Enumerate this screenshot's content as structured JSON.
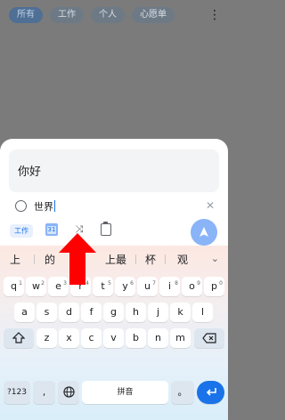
{
  "tabs": [
    {
      "label": "所有",
      "active": true
    },
    {
      "label": "工作",
      "active": false
    },
    {
      "label": "个人",
      "active": false
    },
    {
      "label": "心愿单",
      "active": false
    }
  ],
  "task": {
    "title": "你好",
    "subtask": "世界",
    "list_chip": "工作"
  },
  "keyboard": {
    "candidates": [
      "上",
      "的",
      "上最",
      "杯",
      "观"
    ],
    "row1": [
      [
        "q",
        "1"
      ],
      [
        "w",
        "2"
      ],
      [
        "e",
        "3"
      ],
      [
        "r",
        "4"
      ],
      [
        "t",
        "5"
      ],
      [
        "y",
        "6"
      ],
      [
        "u",
        "7"
      ],
      [
        "i",
        "8"
      ],
      [
        "o",
        "9"
      ],
      [
        "p",
        "0"
      ]
    ],
    "row2": [
      "a",
      "s",
      "d",
      "f",
      "g",
      "h",
      "j",
      "k",
      "l"
    ],
    "row3": [
      "z",
      "x",
      "c",
      "v",
      "b",
      "n",
      "m"
    ],
    "symbols_label": "?123",
    "comma_label": ",",
    "space_label": "拼音",
    "period_label": "。"
  },
  "colors": {
    "accent": "#1a73e8",
    "annotation_arrow": "#ff0000"
  }
}
